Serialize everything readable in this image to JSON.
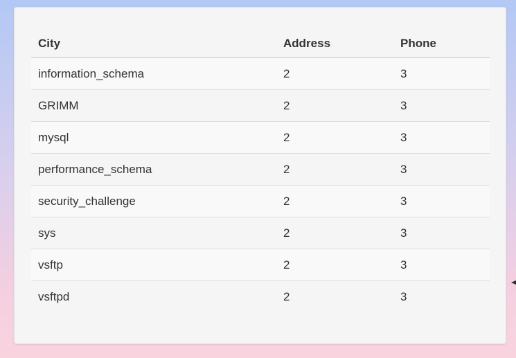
{
  "table": {
    "columns": [
      "City",
      "Address",
      "Phone"
    ],
    "rows": [
      [
        "information_schema",
        "2",
        "3"
      ],
      [
        "GRIMM",
        "2",
        "3"
      ],
      [
        "mysql",
        "2",
        "3"
      ],
      [
        "performance_schema",
        "2",
        "3"
      ],
      [
        "security_challenge",
        "2",
        "3"
      ],
      [
        "sys",
        "2",
        "3"
      ],
      [
        "vsftp",
        "2",
        "3"
      ],
      [
        "vsftpd",
        "2",
        "3"
      ]
    ]
  },
  "colors": {
    "card_background": "#f5f5f5",
    "stripe": "#f9f9f9",
    "border": "#dddddd",
    "text": "#333333"
  },
  "icons": {
    "edge_mark": "arrow-left-icon"
  }
}
